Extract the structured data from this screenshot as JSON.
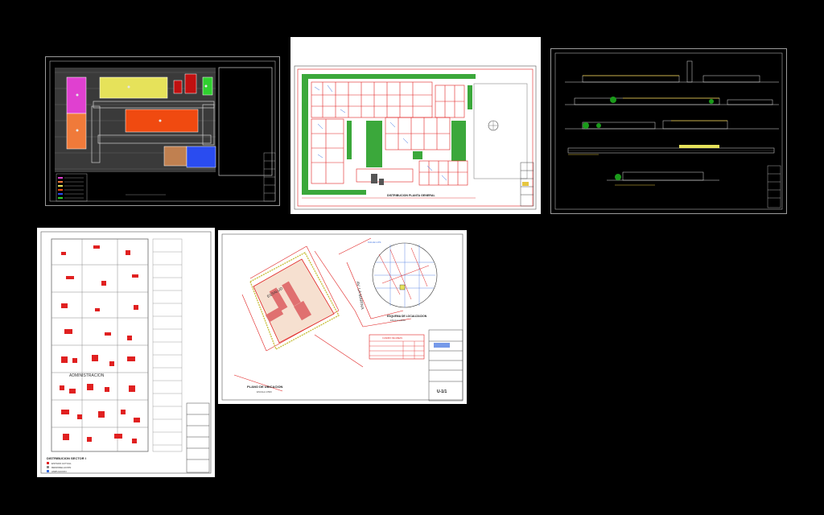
{
  "colors": {
    "canvas": "#000000",
    "sheet_dark": "#000000",
    "sheet_light": "#ffffff",
    "magenta": "#e040d0",
    "orange": "#f07a3a",
    "yellow": "#e6e25a",
    "red": "#f04a10",
    "blue": "#2a4cf0",
    "brown": "#c08050",
    "green": "#2fd02f",
    "cad_red": "#e02020",
    "cad_green": "#1a9a1a"
  },
  "sheets": {
    "site_color_plan": {
      "caption": ""
    },
    "floor_plan": {
      "caption": "DISTRIBUCION PLANTA GENERAL"
    },
    "elevations": {
      "caption": ""
    },
    "sector_plan": {
      "room_label": "ADMINISTRACION",
      "legend_title": "DISTRIBUCION SECTOR I",
      "legend_items": [
        "ESTADO ACTUAL",
        "REMODELACION",
        "AMPLIACION"
      ]
    },
    "location_plan": {
      "street_av": "AV. LA MARINA",
      "street_top": "CALLE LOS",
      "site_name": "ESSALUD",
      "plan_title": "PLANO DE UBICACION",
      "plan_scale": "ESCALA 1/500",
      "loc_title": "ESQUEMA DE LOCALIZACION",
      "loc_scale": "ESCALA 1/5000",
      "sheet_code": "U-1/1",
      "area_table_title": "CUADRO DE AREAS"
    }
  }
}
